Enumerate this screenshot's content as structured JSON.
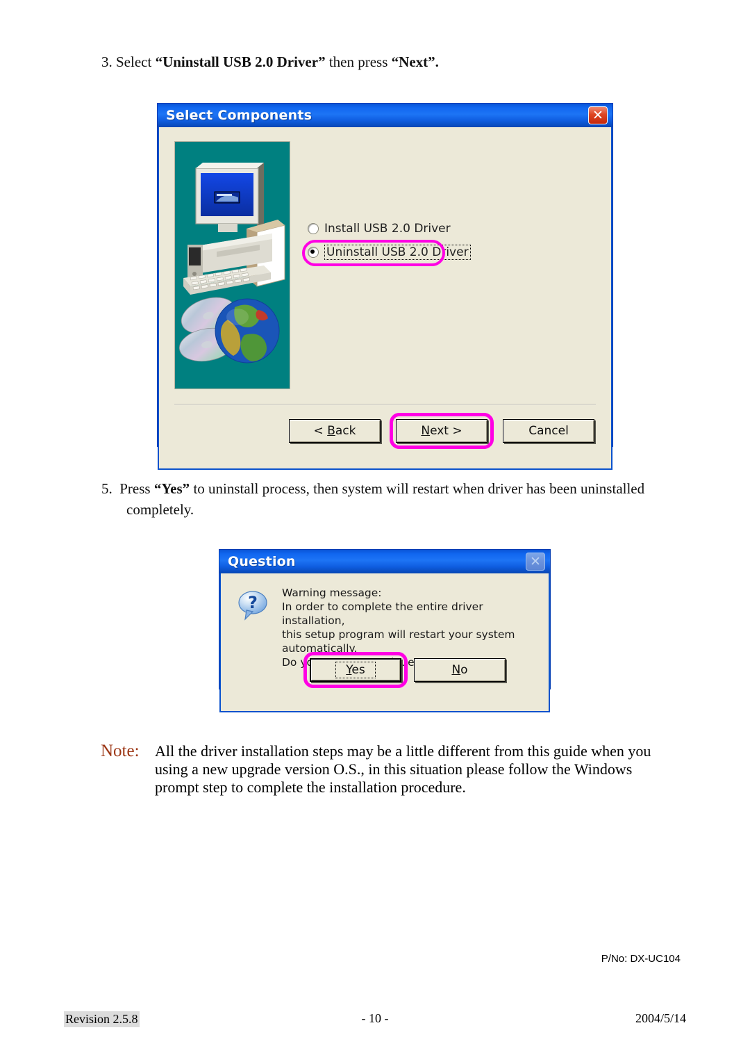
{
  "page": {
    "step3": {
      "number": "3.",
      "text_pre": "Select ",
      "bold1": "“Uninstall USB 2.0 Driver”",
      "text_mid": " then press ",
      "bold2": "“Next”."
    },
    "step5": {
      "number": "5.",
      "text_pre": "Press ",
      "bold1": "“Yes”",
      "text_rest": " to uninstall process, then system will restart when driver has been uninstalled completely."
    },
    "note": {
      "label": "Note:",
      "text": "All the driver installation steps may be a little different from this guide when you using a new upgrade version O.S., in this situation please follow the Windows prompt step to complete the installation procedure.",
      "label_color": "#9c3615"
    },
    "pno": "P/No: DX-UC104",
    "footer": {
      "revision": "Revision 2.5.8",
      "page_number": "- 10 -",
      "date": "2004/5/14"
    }
  },
  "dialog_select_components": {
    "title": "Select Components",
    "close_icon_label": "✕",
    "image_panel": {
      "alt": "computer-illustration",
      "bg_color": "#008080"
    },
    "options": [
      {
        "label": "Install USB 2.0 Driver",
        "selected": false,
        "focused": false
      },
      {
        "label": "Uninstall USB 2.0 Driver",
        "selected": true,
        "focused": true
      }
    ],
    "buttons": [
      {
        "label_pre": "< ",
        "accel": "B",
        "label_post": "ack",
        "highlighted": false
      },
      {
        "label_pre": "",
        "accel": "N",
        "label_post": "ext >",
        "highlighted": true
      },
      {
        "label_pre": "",
        "accel": "",
        "label_post": "Cancel",
        "highlighted": false
      }
    ],
    "highlight_color": "#ff00e4",
    "body_color": "#ece9d8"
  },
  "dialog_question": {
    "title": "Question",
    "close_icon_label": "✕",
    "close_disabled": true,
    "icon": "question-bubble-icon",
    "message": "Warning message:\nIn order to complete the entire driver installation,\nthis setup program will restart your system automatically.\nDo you want to continue?",
    "buttons": [
      {
        "accel": "Y",
        "label_post": "es",
        "highlighted": true
      },
      {
        "accel": "N",
        "label_post": "o",
        "highlighted": false
      }
    ],
    "highlight_color": "#ff00e4"
  }
}
